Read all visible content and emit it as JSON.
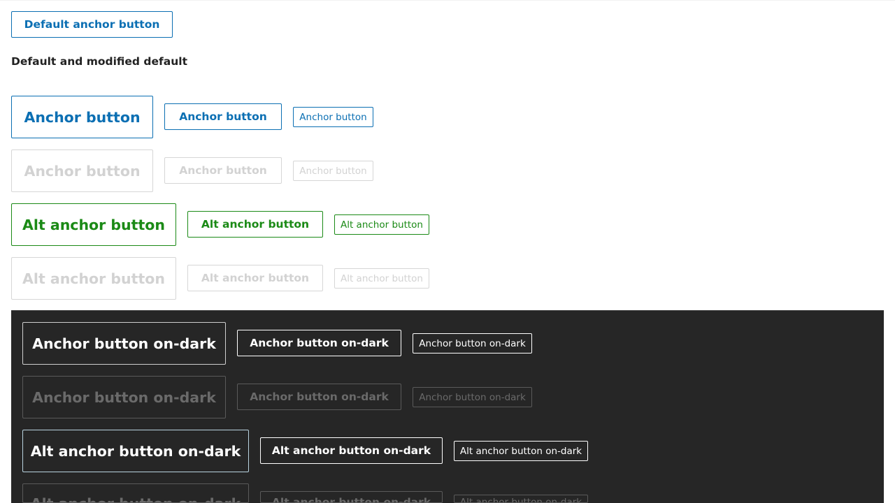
{
  "top_button": {
    "label": "Default anchor button"
  },
  "heading": "Default and modified default",
  "rows": {
    "anchor": {
      "label": "Anchor button"
    },
    "anchor_disabled": {
      "label": "Anchor button"
    },
    "alt_anchor": {
      "label": "Alt anchor button"
    },
    "alt_anchor_disabled": {
      "label": "Alt anchor button"
    },
    "anchor_on_dark": {
      "label": "Anchor button on-dark"
    },
    "anchor_on_dark_disabled": {
      "label": "Anchor button on-dark"
    },
    "alt_anchor_on_dark": {
      "label": "Alt anchor button on-dark"
    },
    "alt_anchor_on_dark_disabled": {
      "label": "Alt anchor button on-dark"
    }
  },
  "colors": {
    "primary_blue": "#0b6fb3",
    "alt_green": "#1b8a16",
    "disabled_light": "#d2d2d2",
    "dark_background": "#262626",
    "disabled_dark": "#6a6a6a",
    "text_heading": "#222222"
  }
}
